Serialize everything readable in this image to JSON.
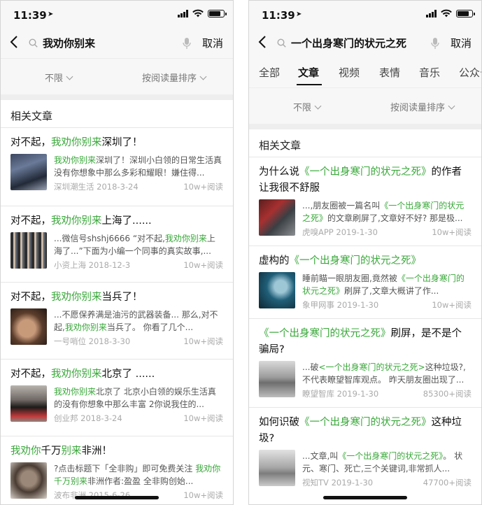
{
  "phones": [
    {
      "status": {
        "time": "11:39"
      },
      "search": {
        "query": "我劝你别来",
        "cancel": "取消"
      },
      "filters": {
        "range": "不限",
        "sort": "按阅读量排序"
      },
      "section_title": "相关文章",
      "articles": [
        {
          "title_prefix": "对不起，",
          "title_hl": "我劝你别来",
          "title_suffix": "深圳了！",
          "snippet_hl": "我劝你别来",
          "snippet": "深圳了！深圳小白领的日常生活真没有你想象中那么多彩和耀眼！嫌住得...",
          "source": "深圳潮生活",
          "date": "2018-3-24",
          "reads": "10w+阅读"
        },
        {
          "title_prefix": "对不起，",
          "title_hl": "我劝你别来",
          "title_suffix": "上海了......",
          "snippet_pre": "...微信号shshj6666 “对不起,",
          "snippet_hl": "我劝你别来",
          "snippet": "上海了...”下面为小编一个同事的真实故事,...",
          "source": "小资上海",
          "date": "2018-12-3",
          "reads": "10w+阅读"
        },
        {
          "title_prefix": "对不起，",
          "title_hl": "我劝你别来",
          "title_suffix": "当兵了！",
          "snippet_pre": "...不愿保养满是油污的武器装备... 那么,对不起,",
          "snippet_hl": "我劝你别来",
          "snippet": "当兵了。 你看了几个...",
          "source": "一号哨位",
          "date": "2018-3-30",
          "reads": "10w+阅读"
        },
        {
          "title_prefix": "对不起，",
          "title_hl": "我劝你别来",
          "title_suffix": "北京了 ......",
          "snippet_hl": "我劝你别来",
          "snippet": "北京了 北京小白领的娱乐生活真的没有你想象中那么丰富 2你说我住的...",
          "source": "创业邦",
          "date": "2018-3-24",
          "reads": "10w+阅读"
        },
        {
          "title_prefix": "",
          "title_hl": "我劝你",
          "title_mid": "千万",
          "title_hl2": "别来",
          "title_suffix": "非洲！",
          "snippet_pre": "?点击标题下「全非购」即可免费关注 ",
          "snippet_hl": "我劝你千万别来",
          "snippet": "非洲作者:盈盈 全非购创始...",
          "source": "波布非洲",
          "date": "2015-6-26",
          "reads": "10w+阅读"
        }
      ]
    },
    {
      "status": {
        "time": "11:39"
      },
      "search": {
        "query": "一个出身寒门的状元之死",
        "cancel": "取消"
      },
      "tabs": [
        "全部",
        "文章",
        "视频",
        "表情",
        "音乐",
        "公众号"
      ],
      "filters": {
        "range": "不限",
        "sort": "按阅读量排序"
      },
      "section_title": "相关文章",
      "articles": [
        {
          "title_prefix": "为什么说",
          "title_hl": "《一个出身寒门的状元之死》",
          "title_suffix": "的作者让我很不舒服",
          "snippet_pre": "...,朋友圈被一篇名叫",
          "snippet_hl": "《一个出身寒门的状元之死》",
          "snippet": "的文章刷屏了,文章好不好? 那是极...",
          "source": "虎嗅APP",
          "date": "2019-1-30",
          "reads": "10w+阅读"
        },
        {
          "title_prefix": "虚构的",
          "title_hl": "《一个出身寒门的状元之死》",
          "title_suffix": "",
          "snippet_pre": "睡前瞄一眼朋友圈,竟然被",
          "snippet_hl": "《一个出身寒门的状元之死》",
          "snippet": "刷屏了,文章大概讲了作...",
          "source": "象甲网事",
          "date": "2019-1-30",
          "reads": "10w+阅读"
        },
        {
          "title_prefix": "",
          "title_hl": "《一个出身寒门的状元之死》",
          "title_suffix": "刷屏，是不是个骗局?",
          "snippet_pre": "...破",
          "snippet_hl": "<一个出身寒门的状元之死>",
          "snippet": "这种垃圾?, 不代表瞭望智库观点。 昨天朋友圈出现了...",
          "source": "瞭望智库",
          "date": "2019-1-30",
          "reads": "85300+阅读"
        },
        {
          "title_prefix": "如何识破",
          "title_hl": "《一个出身寒门的状元之死》",
          "title_suffix": "这种垃圾?",
          "snippet_pre": "...文章,叫",
          "snippet_hl": "《一个出身寒门的状元之死》",
          "snippet": "。 状元、寒门、死亡,三个关键词,非常抓人...",
          "source": "视知TV",
          "date": "2019-1-30",
          "reads": "47700+阅读"
        }
      ]
    }
  ]
}
